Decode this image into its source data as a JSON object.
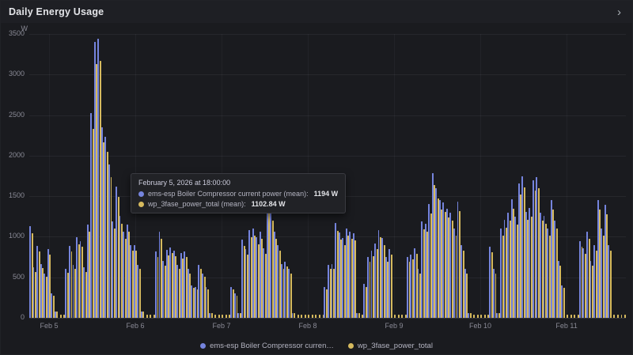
{
  "panel": {
    "title": "Daily Energy Usage"
  },
  "header": {
    "chevron_icon": "›"
  },
  "tooltip": {
    "title": "February 5, 2026 at 18:00:00",
    "rows": [
      {
        "label": "ems-esp Boiler Compressor current power (mean):",
        "value": "1194 W"
      },
      {
        "label": "wp_3fase_power_total (mean):",
        "value": "1102.84 W"
      }
    ]
  },
  "legend": {
    "items": [
      {
        "label": "ems-esp Boiler Compressor curren…"
      },
      {
        "label": "wp_3fase_power_total"
      }
    ]
  },
  "chart_data": {
    "type": "bar",
    "title": "Daily Energy Usage",
    "unit": "W",
    "ylim": [
      0,
      3500
    ],
    "y_ticks": [
      0,
      500,
      1000,
      1500,
      2000,
      2500,
      3000,
      3500
    ],
    "x_start": "Feb 4 19:00",
    "interval": "1h",
    "x_tick_labels": [
      "Feb 5",
      "Feb 6",
      "Feb 7",
      "Feb 8",
      "Feb 9",
      "Feb 10",
      "Feb 11"
    ],
    "x_tick_indices": [
      5,
      29,
      53,
      77,
      101,
      125,
      149
    ],
    "grid": true,
    "legend_position": "bottom-center",
    "series": [
      {
        "name": "ems-esp Boiler Compressor current power (mean)",
        "color": "#7584dd",
        "values": [
          1130,
          620,
          890,
          660,
          550,
          850,
          300,
          80,
          0,
          0,
          600,
          890,
          650,
          990,
          950,
          620,
          1150,
          2530,
          3400,
          3440,
          2350,
          2230,
          1890,
          1194,
          1620,
          1260,
          1060,
          1150,
          900,
          900,
          650,
          80,
          0,
          0,
          0,
          820,
          1060,
          700,
          840,
          870,
          830,
          650,
          800,
          820,
          600,
          400,
          380,
          650,
          550,
          380,
          60,
          0,
          0,
          0,
          0,
          0,
          380,
          300,
          60,
          970,
          850,
          1080,
          1100,
          990,
          1060,
          860,
          1420,
          1300,
          1060,
          900,
          660,
          690,
          600,
          60,
          0,
          0,
          0,
          0,
          0,
          0,
          0,
          0,
          380,
          650,
          660,
          1170,
          1050,
          980,
          1100,
          1060,
          1040,
          60,
          0,
          420,
          750,
          830,
          920,
          1080,
          980,
          750,
          850,
          0,
          0,
          0,
          0,
          750,
          780,
          860,
          600,
          1190,
          1160,
          1400,
          1780,
          1600,
          1450,
          1420,
          1350,
          1300,
          1100,
          1430,
          900,
          600,
          60,
          0,
          0,
          0,
          0,
          0,
          880,
          600,
          60,
          1100,
          1210,
          1300,
          1460,
          1250,
          1660,
          1750,
          1310,
          1360,
          1700,
          1740,
          1300,
          1260,
          1100,
          1450,
          1200,
          700,
          400,
          0,
          0,
          0,
          0,
          950,
          860,
          1060,
          700,
          900,
          1450,
          1100,
          1390,
          900,
          0,
          0,
          0,
          0
        ]
      },
      {
        "name": "wp_3fase_power_total (mean)",
        "color": "#d6ba5e",
        "values": [
          1040,
          570,
          820,
          610,
          505,
          780,
          275,
          74,
          40,
          40,
          552,
          820,
          600,
          910,
          875,
          570,
          1060,
          2330,
          3130,
          3165,
          2160,
          2050,
          1740,
          1103,
          1490,
          1160,
          975,
          1060,
          830,
          830,
          600,
          74,
          40,
          40,
          40,
          755,
          975,
          645,
          775,
          800,
          765,
          600,
          735,
          755,
          550,
          370,
          350,
          600,
          505,
          350,
          55,
          40,
          40,
          40,
          40,
          40,
          350,
          275,
          55,
          890,
          780,
          995,
          1010,
          910,
          975,
          790,
          1305,
          1195,
          975,
          830,
          605,
          635,
          550,
          55,
          40,
          40,
          40,
          40,
          40,
          40,
          40,
          40,
          350,
          600,
          605,
          1075,
          965,
          900,
          1010,
          975,
          955,
          55,
          40,
          385,
          690,
          765,
          845,
          995,
          900,
          690,
          780,
          40,
          40,
          40,
          40,
          690,
          720,
          790,
          550,
          1095,
          1065,
          1290,
          1640,
          1470,
          1335,
          1305,
          1240,
          1195,
          1010,
          1315,
          830,
          550,
          55,
          40,
          40,
          40,
          40,
          40,
          810,
          550,
          55,
          1010,
          1115,
          1195,
          1345,
          1150,
          1525,
          1610,
          1205,
          1250,
          1565,
          1600,
          1195,
          1160,
          1010,
          1335,
          1105,
          645,
          370,
          40,
          40,
          40,
          40,
          875,
          790,
          975,
          645,
          830,
          1335,
          1010,
          1280,
          830,
          40,
          40,
          40,
          40
        ]
      }
    ]
  }
}
